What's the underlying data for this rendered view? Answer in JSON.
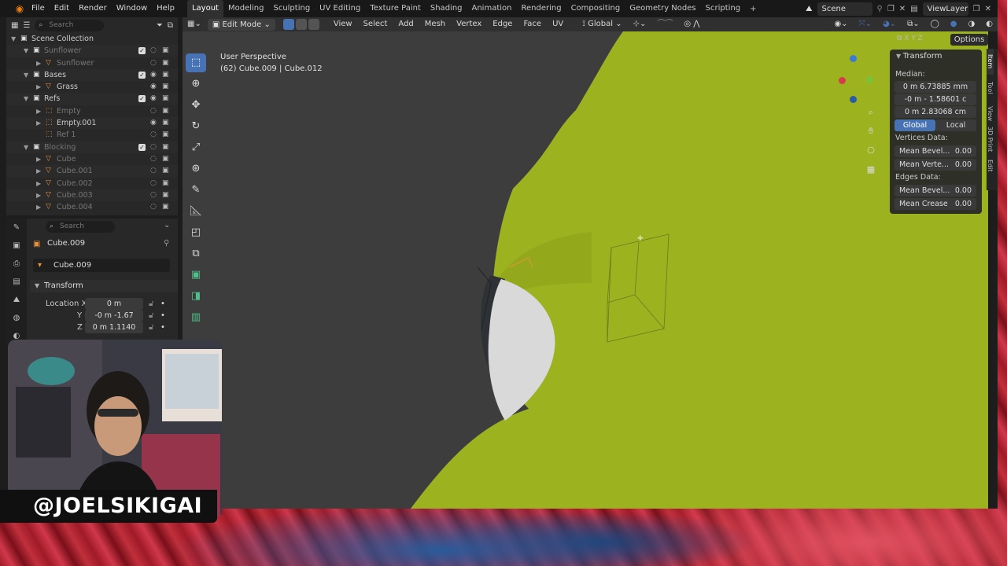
{
  "menu": [
    "File",
    "Edit",
    "Render",
    "Window",
    "Help"
  ],
  "workspaces": [
    "Layout",
    "Modeling",
    "Sculpting",
    "UV Editing",
    "Texture Paint",
    "Shading",
    "Animation",
    "Rendering",
    "Compositing",
    "Geometry Nodes",
    "Scripting"
  ],
  "active_workspace": "Layout",
  "scene_name": "Scene",
  "view_layer": "ViewLayer",
  "outliner": {
    "search_placeholder": "Search",
    "rows": [
      {
        "label": "Scene Collection",
        "kind": "collection",
        "level": 0,
        "dim": false
      },
      {
        "label": "Sunflower",
        "kind": "collection",
        "level": 1,
        "dim": true
      },
      {
        "label": "Sunflower",
        "kind": "object",
        "level": 2,
        "dim": true
      },
      {
        "label": "Bases",
        "kind": "collection",
        "level": 1,
        "dim": false
      },
      {
        "label": "Grass",
        "kind": "object",
        "level": 2,
        "dim": false
      },
      {
        "label": "Refs",
        "kind": "collection",
        "level": 1,
        "dim": false
      },
      {
        "label": "Empty",
        "kind": "empty",
        "level": 2,
        "dim": true
      },
      {
        "label": "Empty.001",
        "kind": "empty",
        "level": 2,
        "dim": false
      },
      {
        "label": "Ref 1",
        "kind": "empty",
        "level": 2,
        "dim": true
      },
      {
        "label": "Blocking",
        "kind": "collection",
        "level": 1,
        "dim": true
      },
      {
        "label": "Cube",
        "kind": "object",
        "level": 2,
        "dim": true
      },
      {
        "label": "Cube.001",
        "kind": "object",
        "level": 2,
        "dim": true
      },
      {
        "label": "Cube.002",
        "kind": "object",
        "level": 2,
        "dim": true
      },
      {
        "label": "Cube.003",
        "kind": "object",
        "level": 2,
        "dim": true
      },
      {
        "label": "Cube.004",
        "kind": "object",
        "level": 2,
        "dim": true
      }
    ]
  },
  "properties": {
    "search_placeholder": "Search",
    "object_name": "Cube.009",
    "data_name": "Cube.009",
    "panel_title": "Transform",
    "location_label": "Location X",
    "loc_x": "0 m",
    "y_label": "Y",
    "loc_y": "-0 m -1.67",
    "z_label": "Z",
    "loc_z": "0 m 1.1140"
  },
  "viewport": {
    "mode": "Edit Mode",
    "menus": [
      "View",
      "Select",
      "Add",
      "Mesh",
      "Vertex",
      "Edge",
      "Face",
      "UV"
    ],
    "orientation": "Global",
    "options_label": "Options",
    "perspective_label": "User Perspective",
    "object_info": "(62) Cube.009 | Cube.012"
  },
  "npanel": {
    "title": "Transform",
    "median_label": "Median:",
    "median_x": "0 m 6.73885 mm",
    "median_y": "-0 m - 1.58601 c",
    "median_z": "0 m 2.83068 cm",
    "global_label": "Global",
    "local_label": "Local",
    "vertices_label": "Vertices Data:",
    "mean_bevel_v_label": "Mean Bevel...",
    "mean_bevel_v": "0.00",
    "mean_vertex_label": "Mean Verte...",
    "mean_vertex": "0.00",
    "edges_label": "Edges Data:",
    "mean_bevel_e_label": "Mean Bevel...",
    "mean_bevel_e": "0.00",
    "mean_crease_label": "Mean Crease",
    "mean_crease": "0.00",
    "tabs": [
      "Item",
      "Tool",
      "View",
      "3D Print",
      "Edit"
    ]
  },
  "overlay": {
    "handle": "@JOELSIKIGAI"
  },
  "colors": {
    "accent": "#4772b3",
    "mesh_green": "#9cb21e",
    "background_red": "#a0202c"
  }
}
